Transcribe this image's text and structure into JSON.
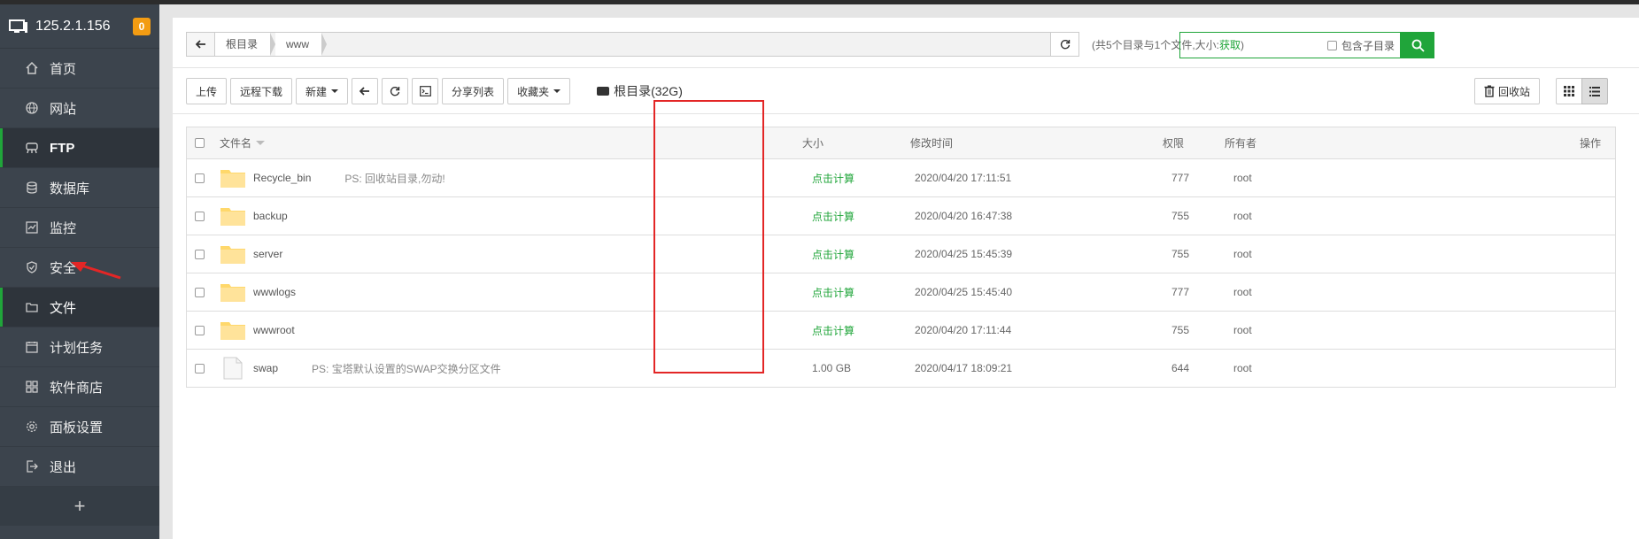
{
  "sidebar": {
    "ip": "125.2.1.156",
    "badge": "0",
    "items": [
      {
        "label": "首页",
        "icon": "home-icon"
      },
      {
        "label": "网站",
        "icon": "globe-icon"
      },
      {
        "label": "FTP",
        "icon": "ftp-icon"
      },
      {
        "label": "数据库",
        "icon": "database-icon"
      },
      {
        "label": "监控",
        "icon": "monitor-icon"
      },
      {
        "label": "安全",
        "icon": "shield-icon"
      },
      {
        "label": "文件",
        "icon": "folder-icon"
      },
      {
        "label": "计划任务",
        "icon": "calendar-icon"
      },
      {
        "label": "软件商店",
        "icon": "grid-icon"
      },
      {
        "label": "面板设置",
        "icon": "gear-icon"
      },
      {
        "label": "退出",
        "icon": "logout-icon"
      }
    ],
    "add": "+"
  },
  "path": {
    "crumbs": [
      "根目录",
      "www"
    ],
    "summary_prefix": "(共5个目录与1个文件,大小:",
    "summary_link": "获取",
    "summary_suffix": ")"
  },
  "search": {
    "include_subdir": "包含子目录"
  },
  "toolbar": {
    "upload": "上传",
    "remote_download": "远程下载",
    "new": "新建",
    "share_list": "分享列表",
    "favorites": "收藏夹",
    "disk": "根目录(32G)",
    "recycle": "回收站"
  },
  "table": {
    "headers": {
      "name": "文件名",
      "size": "大小",
      "mtime": "修改时间",
      "perm": "权限",
      "owner": "所有者",
      "ops": "操作"
    },
    "rows": [
      {
        "name": "Recycle_bin",
        "ps": "PS: 回收站目录,勿动!",
        "size": "点击计算",
        "mtime": "2020/04/20 17:11:51",
        "perm": "777",
        "owner": "root",
        "type": "folder"
      },
      {
        "name": "backup",
        "ps": "",
        "size": "点击计算",
        "mtime": "2020/04/20 16:47:38",
        "perm": "755",
        "owner": "root",
        "type": "folder"
      },
      {
        "name": "server",
        "ps": "",
        "size": "点击计算",
        "mtime": "2020/04/25 15:45:39",
        "perm": "755",
        "owner": "root",
        "type": "folder"
      },
      {
        "name": "wwwlogs",
        "ps": "",
        "size": "点击计算",
        "mtime": "2020/04/25 15:45:40",
        "perm": "777",
        "owner": "root",
        "type": "folder"
      },
      {
        "name": "wwwroot",
        "ps": "",
        "size": "点击计算",
        "mtime": "2020/04/20 17:11:44",
        "perm": "755",
        "owner": "root",
        "type": "folder"
      },
      {
        "name": "swap",
        "ps": "PS: 宝塔默认设置的SWAP交换分区文件",
        "size": "1.00 GB",
        "mtime": "2020/04/17 18:09:21",
        "perm": "644",
        "owner": "root",
        "type": "file"
      }
    ]
  },
  "colors": {
    "accent": "#20a53a",
    "sidebar": "#3c444d",
    "highlight": "#e32626",
    "badge": "#f39c12"
  }
}
